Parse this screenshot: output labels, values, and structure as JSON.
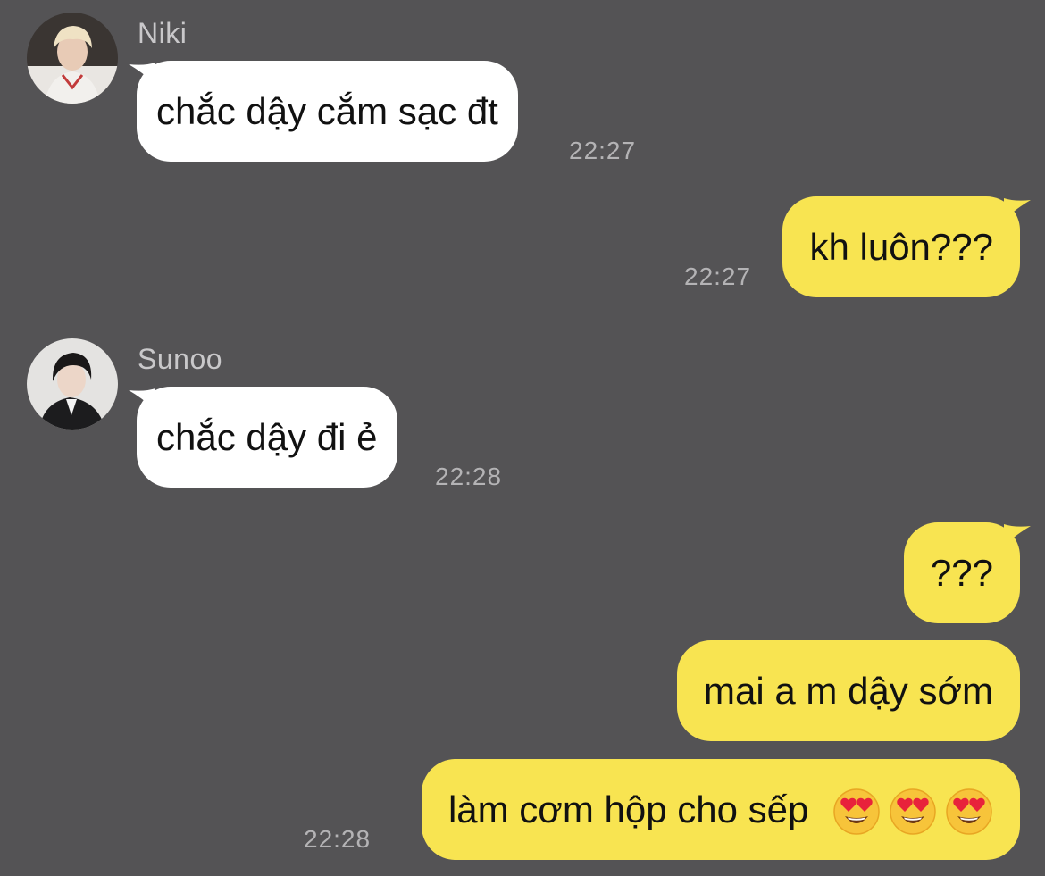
{
  "messages": [
    {
      "sender": "Niki",
      "text": "chắc dậy cắm sạc đt",
      "time": "22:27"
    },
    {
      "sender": "me",
      "text": "kh luôn???",
      "time": "22:27"
    },
    {
      "sender": "Sunoo",
      "text": "chắc dậy đi ẻ",
      "time": "22:28"
    },
    {
      "sender": "me",
      "text": "???"
    },
    {
      "sender": "me",
      "text": "mai a m dậy sớm"
    },
    {
      "sender": "me",
      "text": "làm cơm hộp cho sếp",
      "emojis": [
        "heart-eyes-emoji",
        "heart-eyes-emoji",
        "heart-eyes-emoji"
      ],
      "time": "22:28"
    }
  ],
  "colors": {
    "background": "#545355",
    "incoming_bubble": "#ffffff",
    "outgoing_bubble": "#f8e451",
    "timestamp": "#b4b3b5",
    "sender_name": "#c9c8ca"
  }
}
